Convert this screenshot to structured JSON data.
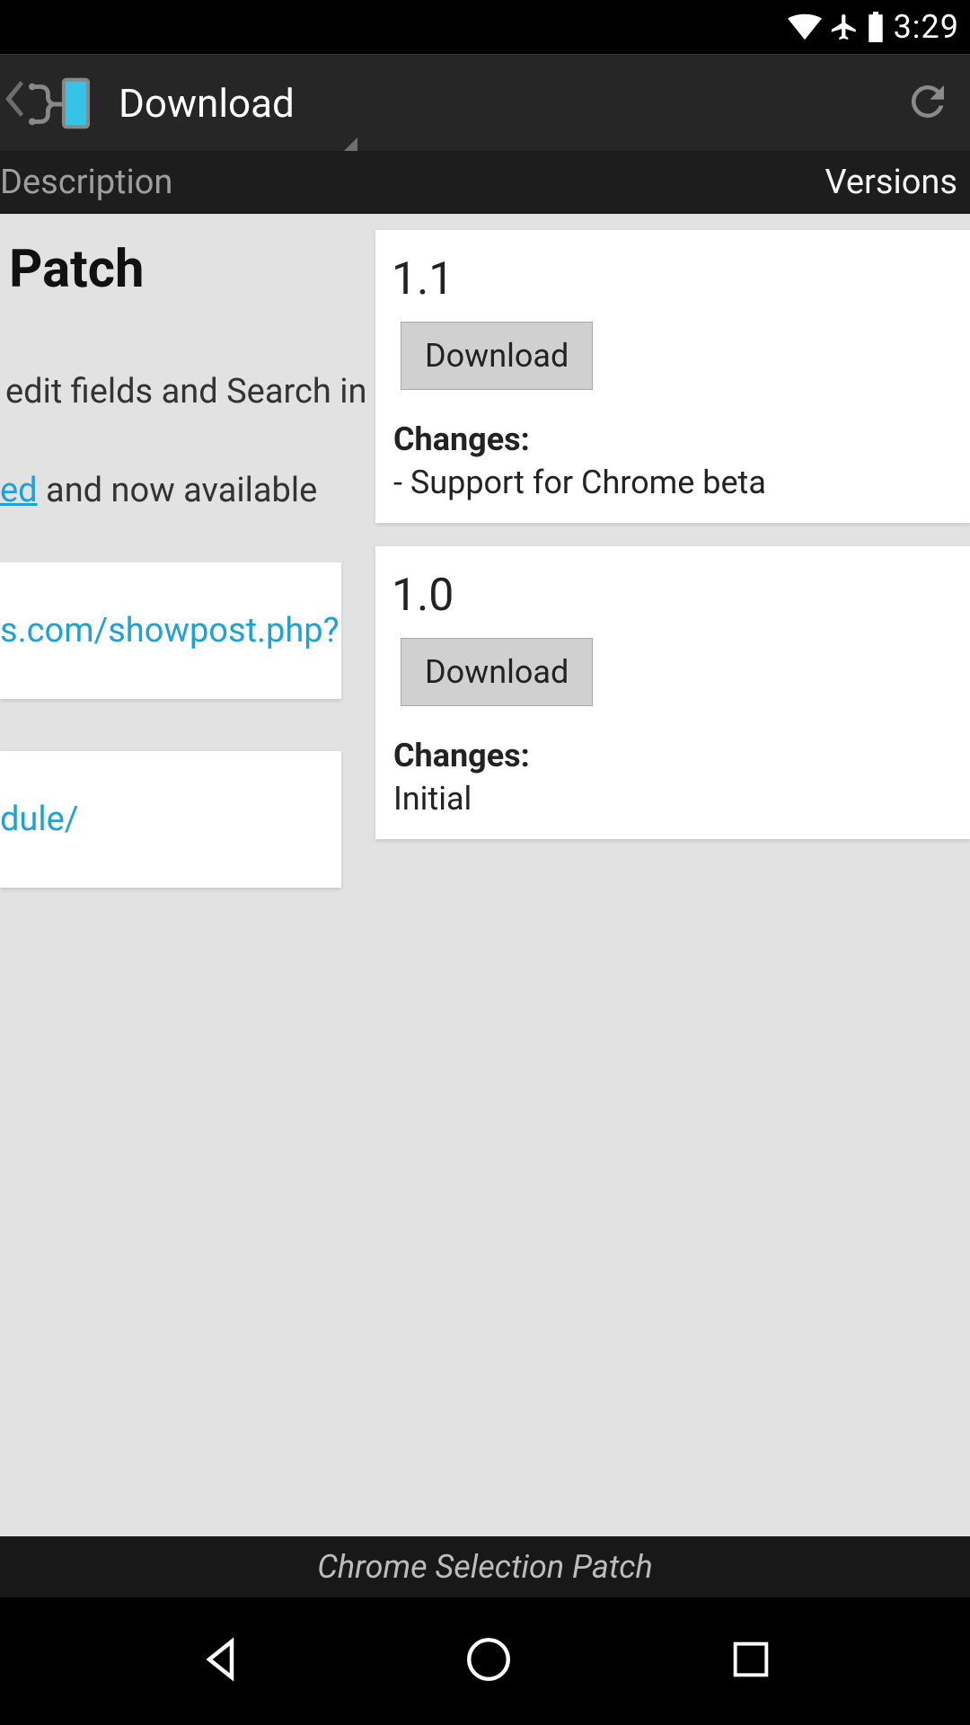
{
  "status": {
    "time": "3:29"
  },
  "actionbar": {
    "title": "Download"
  },
  "tabs": {
    "left": "Description",
    "right": "Versions"
  },
  "description": {
    "heading": "Patch",
    "line1": " edit fields and Search in",
    "line2_link_frag": "ed",
    "line2_rest": " and now available",
    "card1_link": "s.com/showpost.php?",
    "card2_link": "dule/"
  },
  "versions": [
    {
      "number": "1.1",
      "button": "Download",
      "changes_label": "Changes:",
      "changes_text": "- Support for Chrome beta"
    },
    {
      "number": "1.0",
      "button": "Download",
      "changes_label": "Changes:",
      "changes_text": "Initial"
    }
  ],
  "module_name": "Chrome Selection Patch"
}
